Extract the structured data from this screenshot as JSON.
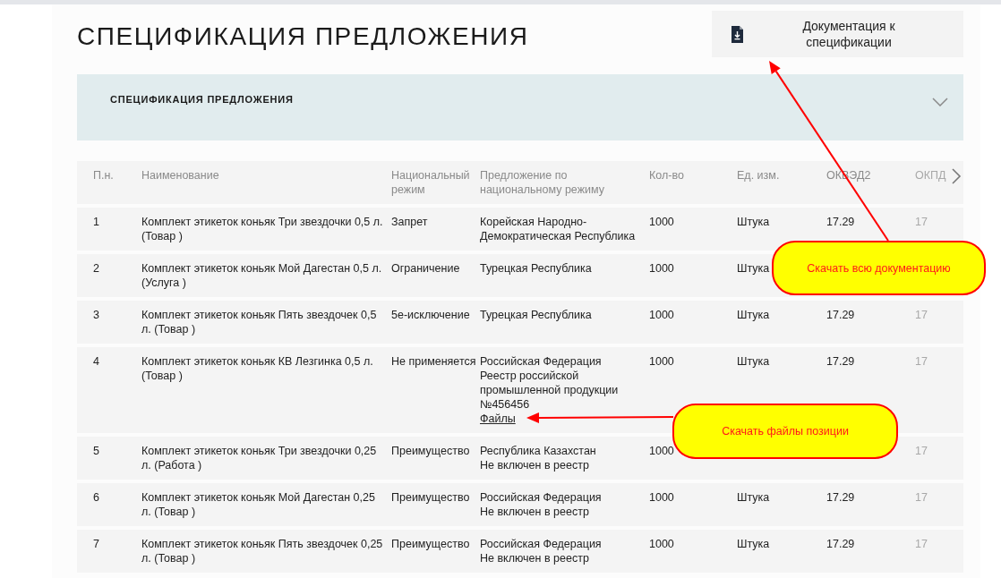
{
  "title": "СПЕЦИФИКАЦИЯ ПРЕДЛОЖЕНИЯ",
  "doc_button": {
    "label": "Документация к спецификации"
  },
  "accordion": {
    "title": "СПЕЦИФИКАЦИЯ ПРЕДЛОЖЕНИЯ",
    "expanded": false
  },
  "table": {
    "columns": [
      "П.н.",
      "Наименование",
      "Национальный режим",
      "Предложение по национальному режиму",
      "Кол-во",
      "Ед. изм.",
      "ОКВЭД2",
      "ОКПД"
    ],
    "rows": [
      {
        "num": "1",
        "name": "Комплект этикеток коньяк Три звездочки 0,5 л. (Товар )",
        "regime": "Запрет",
        "offer": [
          "Корейская Народно-Демократическая Республика"
        ],
        "qty": "1000",
        "unit": "Штука",
        "okved": "17.29",
        "okpd": "17"
      },
      {
        "num": "2",
        "name": "Комплект этикеток коньяк Мой Дагестан 0,5 л. (Услуга )",
        "regime": "Ограничение",
        "offer": [
          "Турецкая Республика"
        ],
        "qty": "1000",
        "unit": "Штука"
      },
      {
        "num": "3",
        "name": "Комплект этикеток коньяк Пять звездочек 0,5 л. (Товар )",
        "regime": "5е-исключение",
        "offer": [
          "Турецкая Республика"
        ],
        "qty": "1000",
        "unit": "Штука",
        "okved": "17.29",
        "okpd": "17"
      },
      {
        "num": "4",
        "name": "Комплект этикеток коньяк КВ Лезгинка 0,5 л. (Товар )",
        "regime": "Не применяется",
        "offer": [
          "Российская Федерация",
          "Реестр российской промышленной продукции №456456"
        ],
        "files_link": "Файлы",
        "qty": "1000",
        "unit": "Штука",
        "okved": "17.29",
        "okpd": "17"
      },
      {
        "num": "5",
        "name": "Комплект этикеток коньяк Три звездочки 0,25 л. (Работа )",
        "regime": "Преимущество",
        "offer": [
          "Республика Казахстан",
          "Не включен в реестр"
        ],
        "qty": "1000",
        "okpd": "17"
      },
      {
        "num": "6",
        "name": "Комплект этикеток коньяк Мой Дагестан 0,25 л. (Товар )",
        "regime": "Преимущество",
        "offer": [
          "Российская Федерация",
          "Не включен в реестр"
        ],
        "qty": "1000",
        "unit": "Штука",
        "okved": "17.29",
        "okpd": "17"
      },
      {
        "num": "7",
        "name": "Комплект этикеток коньяк Пять звездочек 0,25 л. (Товар )",
        "regime": "Преимущество",
        "offer": [
          "Российская Федерация",
          "Не включен в реестр"
        ],
        "qty": "1000",
        "unit": "Штука",
        "okved": "17.29",
        "okpd": "17"
      }
    ]
  },
  "annotations": [
    {
      "text": "Скачать всю документацию"
    },
    {
      "text": "Скачать файлы позиции"
    }
  ]
}
